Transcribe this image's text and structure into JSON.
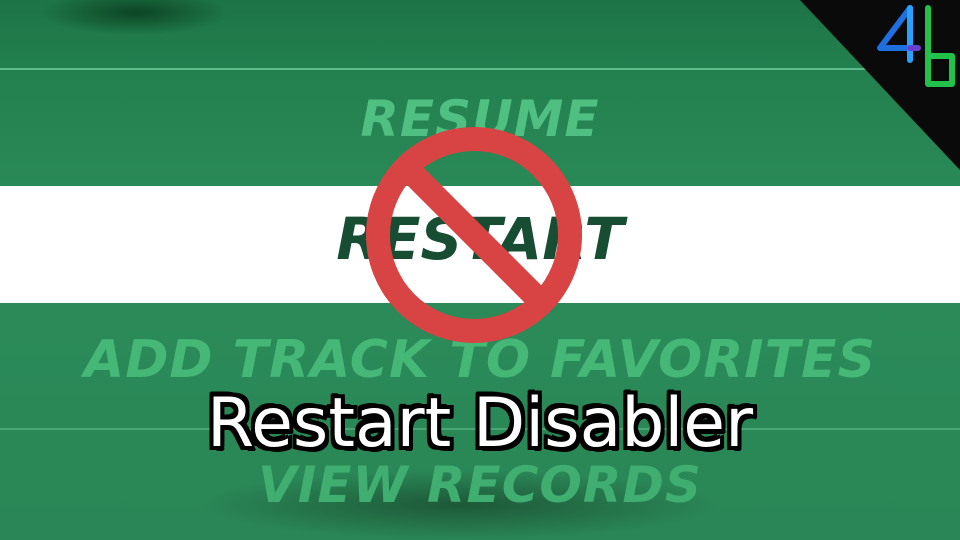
{
  "menu": {
    "items": [
      {
        "label": "RESUME"
      },
      {
        "label": "RESTART"
      },
      {
        "label": "ADD TRACK TO FAVORITES"
      },
      {
        "label": "VIEW RECORDS"
      }
    ]
  },
  "overlay": {
    "title": "Restart Disabler",
    "prohibition_icon": "prohibition-icon",
    "logo_text": "4b"
  },
  "colors": {
    "menu_bg": "#2a8a58",
    "menu_text": "#4fbf82",
    "selected_band": "#ffffff",
    "selected_text": "#174d33",
    "prohibition_red": "#d84343"
  }
}
